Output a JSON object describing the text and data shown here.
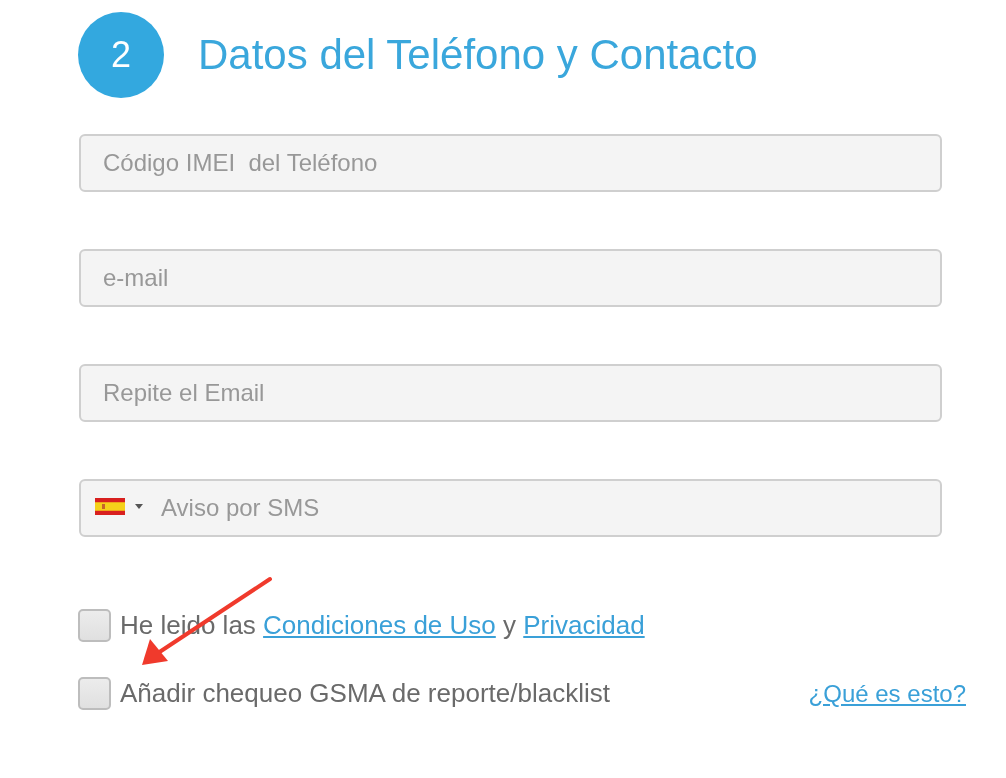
{
  "step": {
    "number": "2",
    "title": "Datos del Teléfono y Contacto"
  },
  "fields": [
    {
      "kind": "text",
      "placeholder": "Código IMEI  del Teléfono"
    },
    {
      "kind": "text",
      "placeholder": "e-mail"
    },
    {
      "kind": "text",
      "placeholder": "Repite el Email"
    },
    {
      "kind": "phone",
      "placeholder": "Aviso por SMS"
    }
  ],
  "checkboxes": [
    {
      "checked": false,
      "parts": [
        {
          "kind": "text",
          "text": "He leido las"
        },
        {
          "kind": "link",
          "text": "Condiciones de Uso"
        },
        {
          "kind": "text",
          "text": "y"
        },
        {
          "kind": "link",
          "text": "Privacidad"
        }
      ]
    },
    {
      "checked": false,
      "parts": [
        {
          "kind": "text",
          "text": "Añadir chequeo GSMA de reporte/blacklist"
        }
      ],
      "help_link": "¿Qué es esto?"
    }
  ]
}
